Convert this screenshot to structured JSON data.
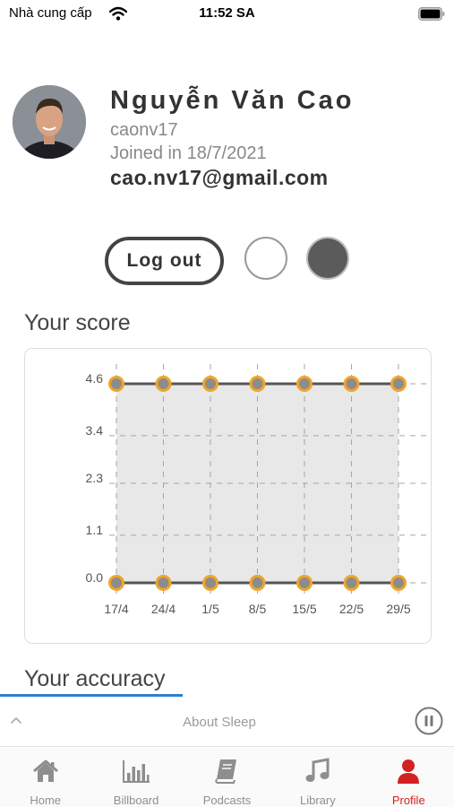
{
  "status_bar": {
    "carrier": "Nhà cung cấp",
    "time": "11:52 SA"
  },
  "profile": {
    "name": "Nguyễn Văn Cao",
    "username": "caonv17",
    "joined": "Joined in 18/7/2021",
    "email": "cao.nv17@gmail.com",
    "logout_label": "Log out"
  },
  "score_section": {
    "title": "Your score"
  },
  "chart_data": {
    "type": "area",
    "title": "",
    "xlabel": "",
    "ylabel": "",
    "categories": [
      "17/4",
      "24/4",
      "1/5",
      "8/5",
      "15/5",
      "22/5",
      "29/5"
    ],
    "y_ticks": [
      "0.0",
      "1.1",
      "2.3",
      "3.4",
      "4.6"
    ],
    "ylim": [
      0,
      4.6
    ],
    "series": [
      {
        "values": [
          4.6,
          4.6,
          4.6,
          4.6,
          4.6,
          4.6,
          4.6
        ]
      },
      {
        "values": [
          0,
          0,
          0,
          0,
          0,
          0,
          0
        ]
      }
    ],
    "fill_between_series": true,
    "grid": "dashed",
    "colors": {
      "fill": "#e8e8e8",
      "line": "#555555",
      "marker_stroke": "#f0a52a",
      "marker_fill": "#8c8c8c"
    }
  },
  "accuracy_section": {
    "title": "Your accuracy"
  },
  "mini_player": {
    "title": "About Sleep",
    "expand_icon": "chevron-up-icon",
    "control_icon": "pause-icon"
  },
  "tab_bar": {
    "active_color": "#d32020",
    "items": [
      {
        "label": "Home",
        "icon": "home-icon"
      },
      {
        "label": "Billboard",
        "icon": "bar-chart-icon"
      },
      {
        "label": "Podcasts",
        "icon": "book-icon"
      },
      {
        "label": "Library",
        "icon": "music-note-icon"
      },
      {
        "label": "Profile",
        "icon": "user-icon",
        "active": true
      }
    ]
  }
}
